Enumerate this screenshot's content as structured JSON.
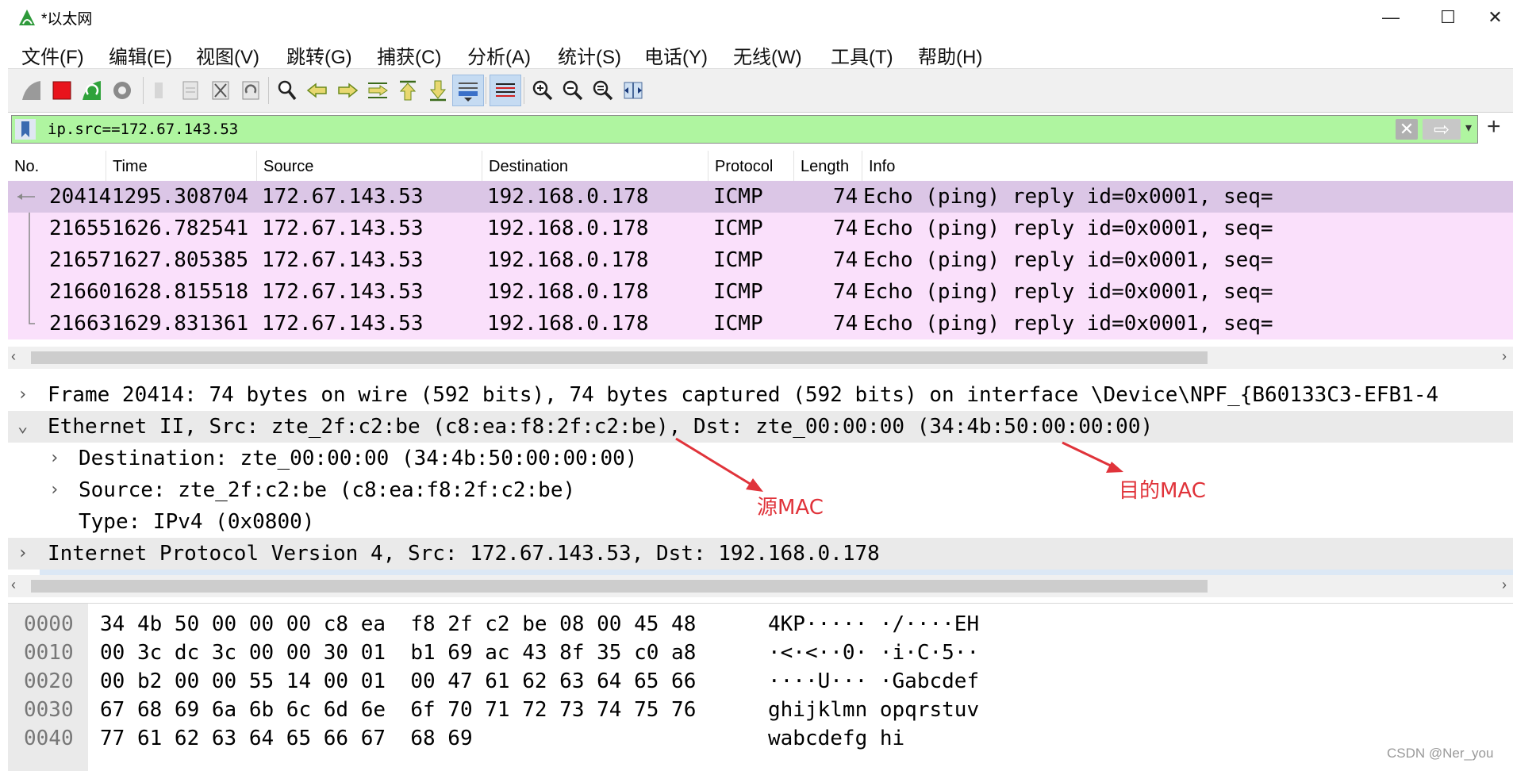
{
  "window": {
    "title": "*以太网",
    "minimize": "—",
    "maximize": "☐",
    "close": "✕"
  },
  "menu": [
    "文件(F)",
    "编辑(E)",
    "视图(V)",
    "跳转(G)",
    "捕获(C)",
    "分析(A)",
    "统计(S)",
    "电话(Y)",
    "无线(W)",
    "工具(T)",
    "帮助(H)"
  ],
  "toolbar": {
    "icons": [
      "shark-fin-start-icon",
      "stop-capture-icon",
      "restart-capture-icon",
      "capture-options-icon",
      "open-file-icon",
      "save-file-icon",
      "close-file-icon",
      "reload-file-icon",
      "find-packet-icon",
      "go-back-icon",
      "go-forward-icon",
      "go-to-packet-icon",
      "go-first-icon",
      "go-last-icon",
      "auto-scroll-icon",
      "colorize-icon",
      "zoom-in-icon",
      "zoom-out-icon",
      "zoom-reset-icon",
      "resize-columns-icon"
    ]
  },
  "filter": {
    "value": "ip.src==172.67.143.53",
    "clear": "✕",
    "apply": "⇨",
    "dropdown": "▾",
    "add": "+"
  },
  "packet_list": {
    "columns": [
      "No.",
      "Time",
      "Source",
      "Destination",
      "Protocol",
      "Length",
      "Info"
    ],
    "rows": [
      {
        "no": "20414",
        "time": "1295.308704",
        "source": "172.67.143.53",
        "destination": "192.168.0.178",
        "protocol": "ICMP",
        "length": "74",
        "info": "Echo (ping) reply    id=0x0001, seq="
      },
      {
        "no": "21655",
        "time": "1626.782541",
        "source": "172.67.143.53",
        "destination": "192.168.0.178",
        "protocol": "ICMP",
        "length": "74",
        "info": "Echo (ping) reply    id=0x0001, seq="
      },
      {
        "no": "21657",
        "time": "1627.805385",
        "source": "172.67.143.53",
        "destination": "192.168.0.178",
        "protocol": "ICMP",
        "length": "74",
        "info": "Echo (ping) reply    id=0x0001, seq="
      },
      {
        "no": "21660",
        "time": "1628.815518",
        "source": "172.67.143.53",
        "destination": "192.168.0.178",
        "protocol": "ICMP",
        "length": "74",
        "info": "Echo (ping) reply    id=0x0001, seq="
      },
      {
        "no": "21663",
        "time": "1629.831361",
        "source": "172.67.143.53",
        "destination": "192.168.0.178",
        "protocol": "ICMP",
        "length": "74",
        "info": "Echo (ping) reply    id=0x0001, seq="
      }
    ]
  },
  "details": [
    {
      "chevron": "›",
      "text": "Frame 20414: 74 bytes on wire (592 bits), 74 bytes captured (592 bits) on interface \\Device\\NPF_{B60133C3-EFB1-4"
    },
    {
      "chevron": "⌄",
      "text": "Ethernet II, Src: zte_2f:c2:be (c8:ea:f8:2f:c2:be), Dst: zte_00:00:00 (34:4b:50:00:00:00)"
    },
    {
      "chevron": "›",
      "text": "Destination: zte_00:00:00 (34:4b:50:00:00:00)"
    },
    {
      "chevron": "›",
      "text": "Source: zte_2f:c2:be (c8:ea:f8:2f:c2:be)"
    },
    {
      "chevron": "",
      "text": "Type: IPv4 (0x0800)"
    },
    {
      "chevron": "›",
      "text": "Internet Protocol Version 4, Src: 172.67.143.53, Dst: 192.168.0.178"
    }
  ],
  "annotations": {
    "src_mac": "源MAC",
    "dst_mac": "目的MAC"
  },
  "bytes": {
    "offsets": [
      "0000",
      "0010",
      "0020",
      "0030",
      "0040"
    ],
    "hex": [
      "34 4b 50 00 00 00 c8 ea  f8 2f c2 be 08 00 45 48",
      "00 3c dc 3c 00 00 30 01  b1 69 ac 43 8f 35 c0 a8",
      "00 b2 00 00 55 14 00 01  00 47 61 62 63 64 65 66",
      "67 68 69 6a 6b 6c 6d 6e  6f 70 71 72 73 74 75 76",
      "77 61 62 63 64 65 66 67  68 69"
    ],
    "ascii": [
      "4KP····· ·/····EH",
      "·<·<··0· ·i·C·5··",
      "····U··· ·Gabcdef",
      "ghijklmn opqrstuv",
      "wabcdefg hi"
    ]
  },
  "watermark": "CSDN @Ner_you",
  "colors": {
    "filter_bg": "#aff5a0",
    "row_bg": "#fae0fb",
    "row_selected_bg": "#dbc6e6",
    "annotation": "#e0333a"
  }
}
